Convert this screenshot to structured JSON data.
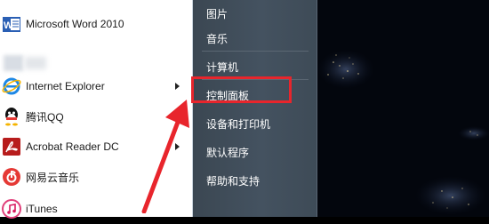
{
  "programs": [
    {
      "label": "Microsoft Word 2010",
      "icon": "word-icon"
    },
    {
      "label": "Internet Explorer",
      "icon": "ie-icon",
      "submenu": true
    },
    {
      "label": "腾讯QQ",
      "icon": "qq-icon"
    },
    {
      "label": "Acrobat Reader DC",
      "icon": "acrobat-icon",
      "submenu": true
    },
    {
      "label": "网易云音乐",
      "icon": "netease-music-icon"
    },
    {
      "label": "iTunes",
      "icon": "itunes-icon"
    }
  ],
  "right_menu": {
    "items": [
      {
        "label": "图片"
      },
      {
        "label": "音乐"
      },
      {
        "label": "计算机"
      },
      {
        "label": "控制面板"
      },
      {
        "label": "设备和打印机"
      },
      {
        "label": "默认程序"
      },
      {
        "label": "帮助和支持"
      }
    ]
  },
  "colors": {
    "highlight": "#e8252c",
    "right_pane": "#445260",
    "desktop": "#03060d"
  }
}
